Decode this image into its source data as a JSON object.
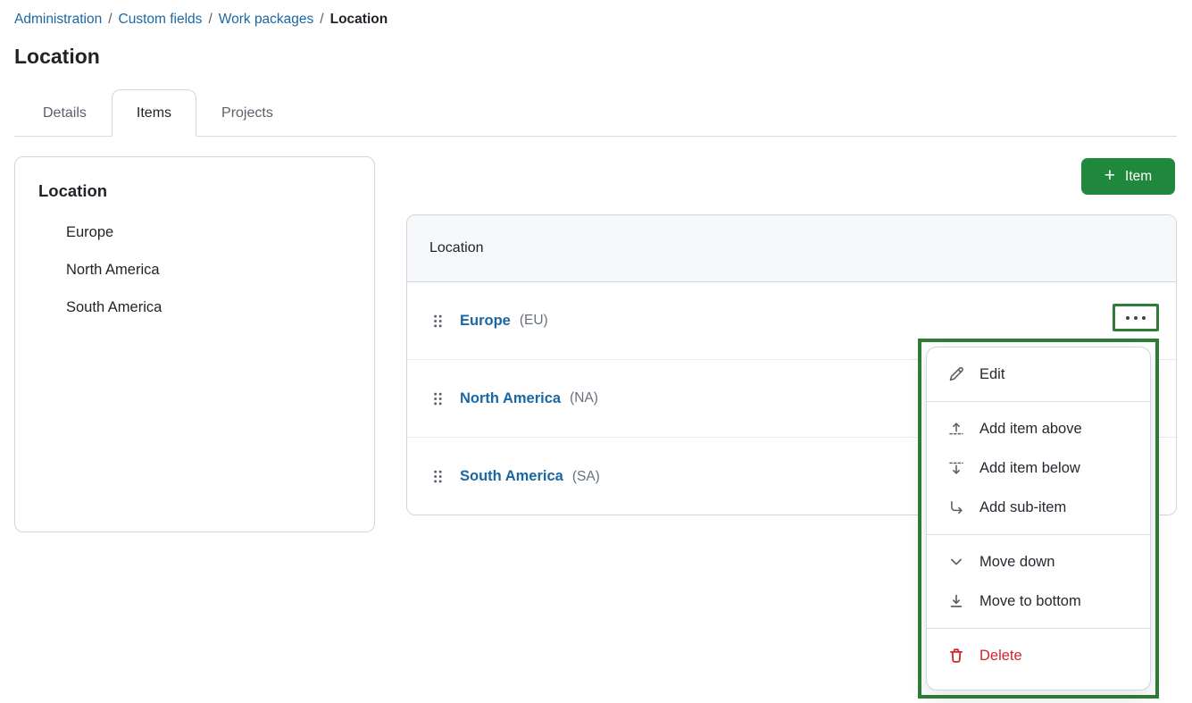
{
  "breadcrumb": {
    "separator": "/",
    "items": [
      {
        "label": "Administration"
      },
      {
        "label": "Custom fields"
      },
      {
        "label": "Work packages"
      }
    ],
    "current": "Location"
  },
  "page": {
    "title": "Location"
  },
  "tabs": [
    {
      "label": "Details",
      "active": false
    },
    {
      "label": "Items",
      "active": true
    },
    {
      "label": "Projects",
      "active": false
    }
  ],
  "sidebar_card": {
    "title": "Location",
    "items": [
      "Europe",
      "North America",
      "South America"
    ]
  },
  "toolbar": {
    "plus_glyph": "+",
    "item_button_label": "Item"
  },
  "table": {
    "header": "Location",
    "rows": [
      {
        "name": "Europe",
        "code": "(EU)"
      },
      {
        "name": "North America",
        "code": "(NA)"
      },
      {
        "name": "South America",
        "code": "(SA)"
      }
    ]
  },
  "menu_trigger": {
    "icon": "ellipsis-icon"
  },
  "context_menu": {
    "sections": [
      {
        "items": [
          {
            "icon": "pencil-icon",
            "label": "Edit"
          }
        ]
      },
      {
        "items": [
          {
            "icon": "insert-above-icon",
            "label": "Add item above"
          },
          {
            "icon": "insert-below-icon",
            "label": "Add item below"
          },
          {
            "icon": "sub-item-icon",
            "label": "Add sub-item"
          }
        ]
      },
      {
        "items": [
          {
            "icon": "chevron-down-icon",
            "label": "Move down"
          },
          {
            "icon": "move-to-bottom-icon",
            "label": "Move to bottom"
          }
        ]
      },
      {
        "items": [
          {
            "icon": "trash-icon",
            "label": "Delete"
          }
        ]
      }
    ]
  },
  "colors": {
    "link_blue": "#1A67A3",
    "button_green": "#1F883D",
    "selection_green": "#2D7D36",
    "danger_red": "#D1242F",
    "header_gray": "#F6F8FA",
    "border_gray": "#D0D7DE"
  }
}
